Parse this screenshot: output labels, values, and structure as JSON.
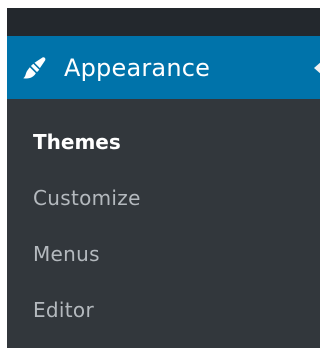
{
  "menu": {
    "active_item": {
      "label": "Appearance",
      "icon": "paintbrush-icon"
    },
    "submenu": [
      {
        "label": "Themes",
        "current": true
      },
      {
        "label": "Customize",
        "current": false
      },
      {
        "label": "Menus",
        "current": false
      },
      {
        "label": "Editor",
        "current": false
      }
    ]
  },
  "colors": {
    "menu_background": "#23282d",
    "submenu_background": "#32373c",
    "active_background": "#0073aa",
    "active_text": "#ffffff",
    "submenu_text": "#b4b9be"
  }
}
